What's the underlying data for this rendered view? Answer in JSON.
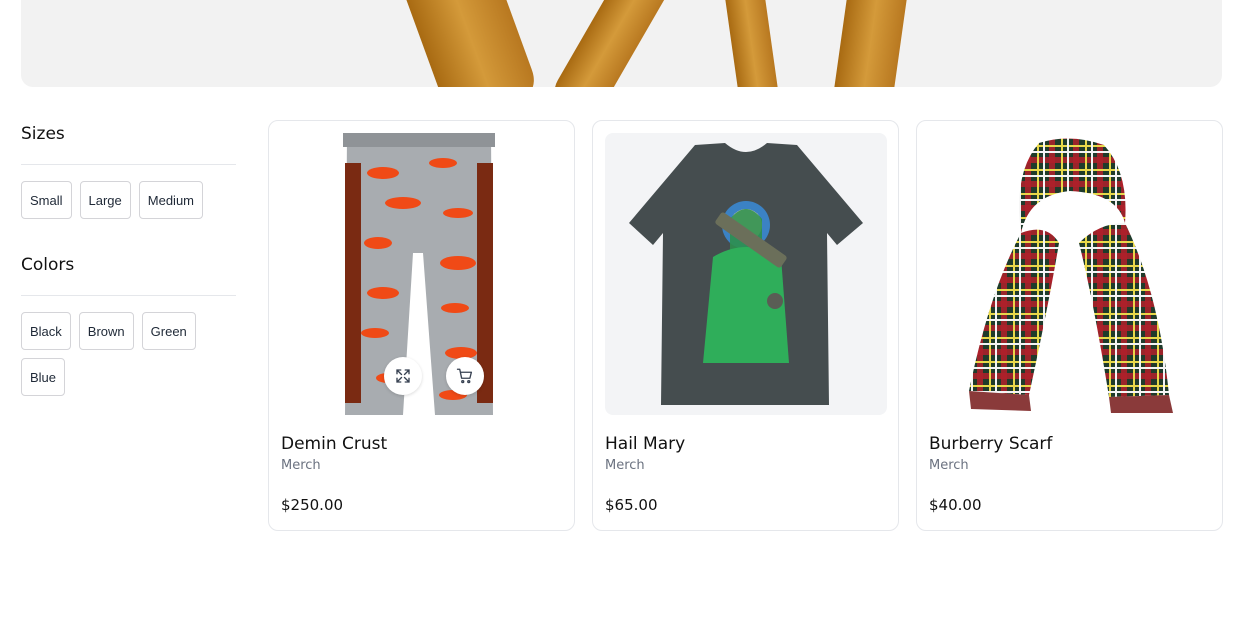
{
  "filters": {
    "sizes": {
      "title": "Sizes",
      "options": [
        "Small",
        "Large",
        "Medium"
      ]
    },
    "colors": {
      "title": "Colors",
      "options": [
        "Black",
        "Brown",
        "Green",
        "Blue"
      ]
    }
  },
  "products": [
    {
      "name": "Demin Crust",
      "category": "Merch",
      "price": "$250.00"
    },
    {
      "name": "Hail Mary",
      "category": "Merch",
      "price": "$65.00"
    },
    {
      "name": "Burberry Scarf",
      "category": "Merch",
      "price": "$40.00"
    }
  ],
  "icons": {
    "expand": "expand-icon",
    "cart": "shopping-cart-icon"
  },
  "colors": {
    "card_border": "#e5e7eb",
    "muted_text": "#6b7280",
    "hero_bg": "#f2f2f2"
  }
}
